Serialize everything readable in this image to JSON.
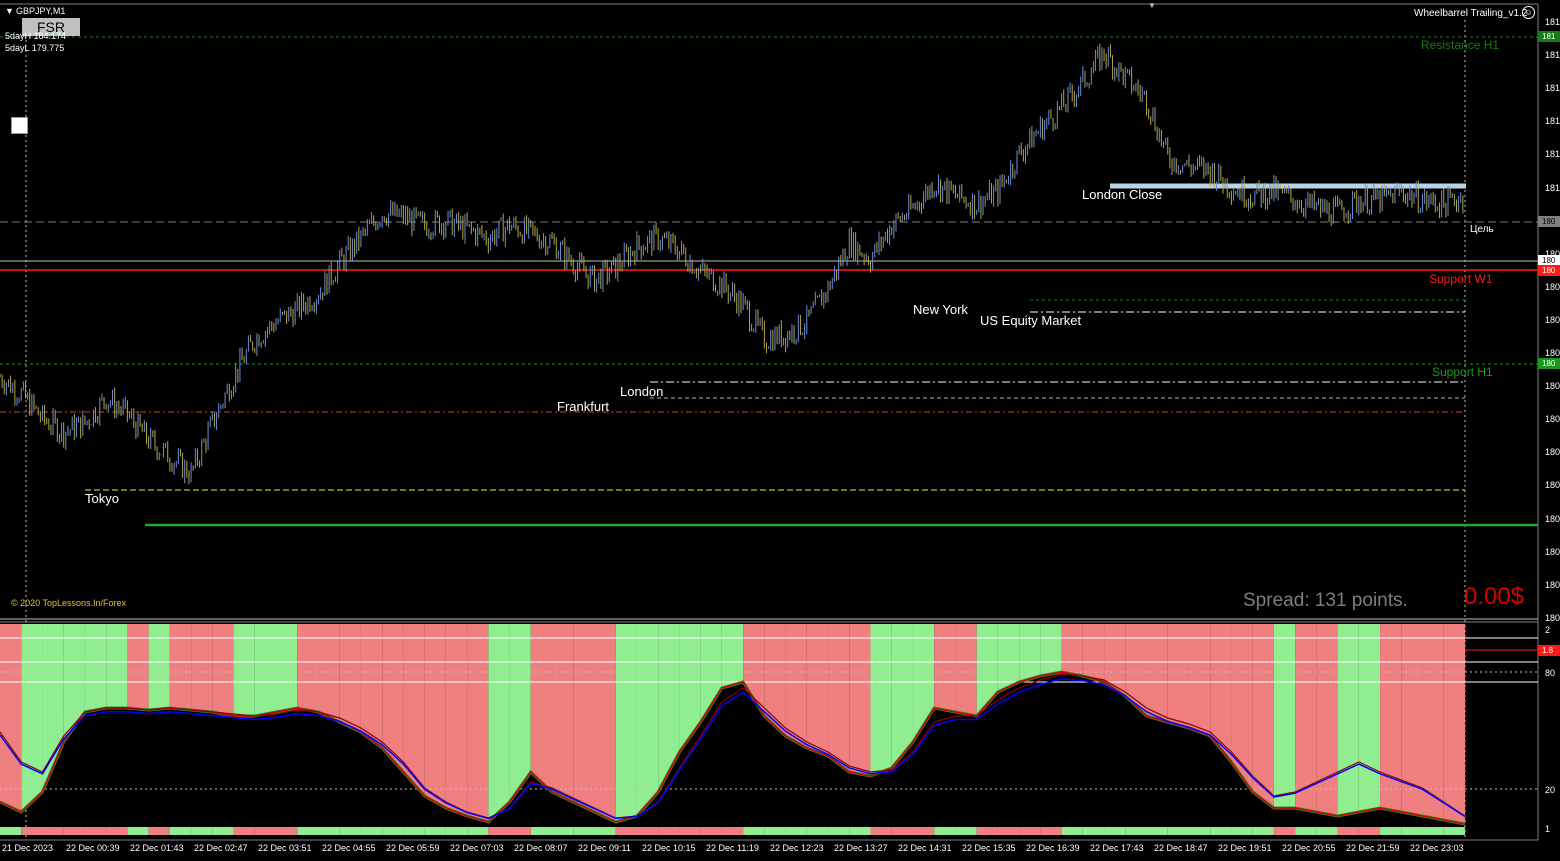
{
  "window": {
    "symbol_title": "GBPJPY,M1",
    "symbol_button": "FSR",
    "day_high": "5dayH 184.174",
    "day_low": "5dayL 179.775",
    "ea_name": "Wheelbarrel Trailing_v1.2",
    "ea_icon": "smile-icon",
    "copyright": "© 2020 TopLessons.In/Forex",
    "spread": "Spread: 131 points.",
    "profit": "0.00$"
  },
  "levels": {
    "resistance_h1": "Resistance H1",
    "support_w1": "Support W1",
    "support_h1": "Support H1",
    "target": "Цель",
    "london_close": "London Close"
  },
  "sessions": {
    "tokyo": "Tokyo",
    "frankfurt": "Frankfurt",
    "london": "London",
    "new_york": "New York",
    "us_equity": "US Equity Market"
  },
  "price_axis": [
    "181",
    "181",
    "181",
    "181",
    "181",
    "181",
    "180",
    "180",
    "180",
    "180",
    "180",
    "180",
    "180",
    "180",
    "180",
    "180",
    "180",
    "180",
    "180",
    "179"
  ],
  "price_tags": {
    "resistance": "181",
    "target": "180",
    "current": "180",
    "support_w1": "180",
    "support_h1": "180"
  },
  "osc_axis": {
    "top": "2",
    "upper": "80",
    "lower": "20",
    "bottom": "1",
    "red_tag": "1.8"
  },
  "time_axis": [
    "21 Dec 2023",
    "22 Dec 00:39",
    "22 Dec 01:43",
    "22 Dec 02:47",
    "22 Dec 03:51",
    "22 Dec 04:55",
    "22 Dec 05:59",
    "22 Dec 07:03",
    "22 Dec 08:07",
    "22 Dec 09:11",
    "22 Dec 10:15",
    "22 Dec 11:19",
    "22 Dec 12:23",
    "22 Dec 13:27",
    "22 Dec 14:31",
    "22 Dec 15:35",
    "22 Dec 16:39",
    "22 Dec 17:43",
    "22 Dec 18:47",
    "22 Dec 19:51",
    "22 Dec 20:55",
    "22 Dec 21:59",
    "22 Dec 23:03"
  ],
  "colors": {
    "background": "#000000",
    "candle_up": "#6b8fd6",
    "candle_down": "#b5a642",
    "resistance": "#1a7a1a",
    "support_w1": "#ff1a1a",
    "support_h1": "#1a9a1a",
    "osc_green": "#90ee90",
    "osc_red": "#f08080",
    "osc_line": "#cc0000",
    "osc_signal": "#0000ff",
    "spread": "#7d7d7d",
    "profit": "#d90000"
  },
  "chart_data": {
    "type": "line",
    "series": [
      {
        "values": [
          0.53,
          0.49,
          0.43,
          0.4,
          0.42,
          0.48,
          0.44,
          0.38,
          0.34,
          0.3,
          0.42,
          0.53,
          0.62,
          0.66,
          0.69,
          0.73,
          0.8,
          0.86,
          0.92,
          0.91,
          0.89,
          0.9,
          0.88,
          0.86,
          0.89,
          0.87,
          0.85,
          0.8,
          0.76,
          0.79,
          0.84,
          0.86,
          0.83,
          0.78,
          0.75,
          0.7,
          0.62,
          0.63,
          0.66,
          0.74,
          0.85,
          0.81,
          0.89,
          0.93,
          0.99,
          0.96,
          0.94,
          0.97,
          1.06,
          1.12,
          1.17,
          1.23,
          1.3,
          1.24,
          1.19,
          1.05,
          1.03,
          1.02,
          0.98,
          0.96,
          0.97,
          0.95,
          0.93,
          0.92,
          0.95,
          0.95,
          0.97,
          0.95,
          0.94,
          0.96
        ]
      },
      {
        "values": [
          0.15,
          0.1,
          0.2,
          0.45,
          0.6,
          0.62,
          0.62,
          0.61,
          0.62,
          0.61,
          0.6,
          0.58,
          0.58,
          0.6,
          0.62,
          0.6,
          0.55,
          0.5,
          0.42,
          0.3,
          0.18,
          0.12,
          0.08,
          0.05,
          0.15,
          0.3,
          0.2,
          0.15,
          0.1,
          0.05,
          0.08,
          0.2,
          0.4,
          0.55,
          0.72,
          0.75,
          0.58,
          0.48,
          0.42,
          0.38,
          0.3,
          0.28,
          0.32,
          0.45,
          0.62,
          0.6,
          0.58,
          0.7,
          0.75,
          0.78,
          0.8,
          0.78,
          0.75,
          0.68,
          0.58,
          0.55,
          0.52,
          0.48,
          0.35,
          0.2,
          0.12,
          0.12,
          0.1,
          0.08,
          0.1,
          0.12,
          0.1,
          0.08,
          0.06,
          0.04
        ]
      },
      {
        "values": [
          0.5,
          0.35,
          0.3,
          0.48,
          0.6,
          0.62,
          0.62,
          0.61,
          0.62,
          0.61,
          0.6,
          0.59,
          0.58,
          0.59,
          0.61,
          0.6,
          0.57,
          0.52,
          0.45,
          0.35,
          0.22,
          0.15,
          0.1,
          0.07,
          0.12,
          0.25,
          0.22,
          0.17,
          0.12,
          0.07,
          0.08,
          0.15,
          0.32,
          0.48,
          0.65,
          0.72,
          0.62,
          0.52,
          0.45,
          0.4,
          0.33,
          0.3,
          0.31,
          0.4,
          0.55,
          0.58,
          0.58,
          0.66,
          0.72,
          0.76,
          0.79,
          0.78,
          0.76,
          0.7,
          0.62,
          0.57,
          0.54,
          0.5,
          0.4,
          0.28,
          0.18,
          0.2,
          0.25,
          0.3,
          0.35,
          0.3,
          0.26,
          0.22,
          0.15,
          0.08
        ]
      }
    ]
  }
}
